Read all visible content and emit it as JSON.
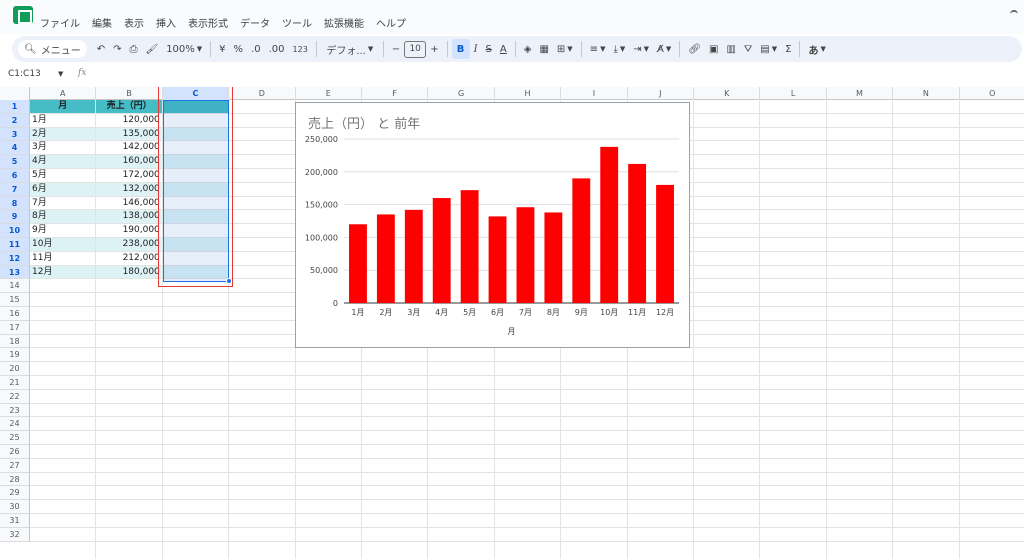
{
  "menu": {
    "items": [
      "ファイル",
      "編集",
      "表示",
      "挿入",
      "表示形式",
      "データ",
      "ツール",
      "拡張機能",
      "ヘルプ"
    ]
  },
  "toolbar": {
    "search_label": "メニュー",
    "zoom": "100%",
    "currency": "¥",
    "percent": "%",
    "decrease_decimal": ".0",
    "increase_decimal": ".00",
    "number_format": "123",
    "font": "デフォ...",
    "font_size": "10",
    "bold": "B",
    "functions": "Σ",
    "input_tool": "あ"
  },
  "formula_bar": {
    "name_box": "C1:C13",
    "fx": "fx"
  },
  "grid": {
    "columns": [
      "A",
      "B",
      "C",
      "D",
      "E",
      "F",
      "G",
      "H",
      "I",
      "J",
      "K",
      "L",
      "M",
      "N",
      "O"
    ],
    "selected_column": "C",
    "rows": [
      "1",
      "2",
      "3",
      "4",
      "5",
      "6",
      "7",
      "8",
      "9",
      "10",
      "11",
      "12",
      "13",
      "14",
      "15",
      "16",
      "17",
      "18",
      "19",
      "20",
      "21",
      "22",
      "23",
      "24",
      "25",
      "26",
      "27",
      "28",
      "29",
      "30",
      "31",
      "32"
    ],
    "header": {
      "a": "月",
      "b": "売上（円）"
    },
    "data": [
      {
        "month": "1月",
        "sales": "120,000"
      },
      {
        "month": "2月",
        "sales": "135,000"
      },
      {
        "month": "3月",
        "sales": "142,000"
      },
      {
        "month": "4月",
        "sales": "160,000"
      },
      {
        "month": "5月",
        "sales": "172,000"
      },
      {
        "month": "6月",
        "sales": "132,000"
      },
      {
        "month": "7月",
        "sales": "146,000"
      },
      {
        "month": "8月",
        "sales": "138,000"
      },
      {
        "month": "9月",
        "sales": "190,000"
      },
      {
        "month": "10月",
        "sales": "238,000"
      },
      {
        "month": "11月",
        "sales": "212,000"
      },
      {
        "month": "12月",
        "sales": "180,000"
      }
    ]
  },
  "colors": {
    "bar": "#ff0000",
    "header_fill": "#46bdc6",
    "band_fill": "#ddf2f4",
    "selection": "#1a73e8",
    "annotation": "#e53935"
  },
  "chart_data": {
    "type": "bar",
    "title": "売上（円） と 前年",
    "xlabel": "月",
    "ylabel": "",
    "categories": [
      "1月",
      "2月",
      "3月",
      "4月",
      "5月",
      "6月",
      "7月",
      "8月",
      "9月",
      "10月",
      "11月",
      "12月"
    ],
    "series": [
      {
        "values": [
          120000,
          135000,
          142000,
          160000,
          172000,
          132000,
          146000,
          138000,
          190000,
          238000,
          212000,
          180000
        ]
      }
    ],
    "ylim": [
      0,
      250000
    ],
    "yticks": [
      "0",
      "50,000",
      "100,000",
      "150,000",
      "200,000",
      "250,000"
    ],
    "grid": true,
    "legend": "none"
  }
}
